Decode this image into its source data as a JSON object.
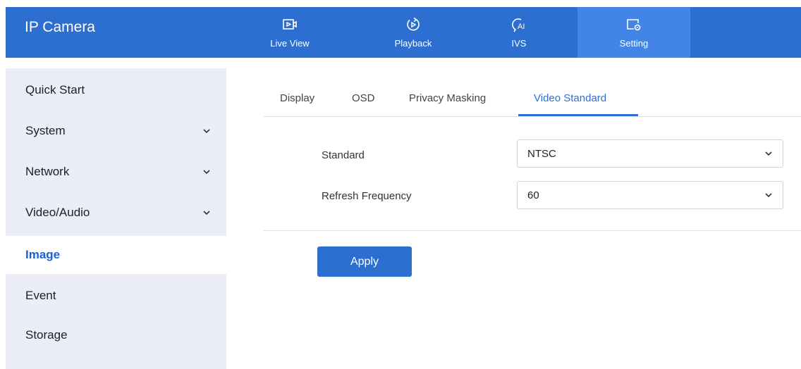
{
  "header": {
    "app_title": "IP Camera",
    "tabs": [
      {
        "label": "Live View",
        "icon": "live-view-icon"
      },
      {
        "label": "Playback",
        "icon": "playback-icon"
      },
      {
        "label": "IVS",
        "icon": "ai-icon"
      },
      {
        "label": "Setting",
        "icon": "setting-icon",
        "active": true
      }
    ],
    "color": "#2d6fd1",
    "active_color": "#4385e6"
  },
  "sidebar": {
    "items": [
      {
        "label": "Quick Start"
      },
      {
        "label": "System",
        "expandable": true
      },
      {
        "label": "Network",
        "expandable": true
      },
      {
        "label": "Video/Audio",
        "expandable": true
      },
      {
        "label": "Image",
        "active": true
      },
      {
        "label": "Event"
      },
      {
        "label": "Storage"
      }
    ]
  },
  "content": {
    "tabs": [
      {
        "label": "Display"
      },
      {
        "label": "OSD"
      },
      {
        "label": "Privacy Masking"
      },
      {
        "label": "Video Standard",
        "active": true
      }
    ],
    "fields": {
      "standard": {
        "label": "Standard",
        "value": "NTSC"
      },
      "refresh": {
        "label": "Refresh Frequency",
        "value": "60"
      }
    },
    "apply_label": "Apply"
  }
}
